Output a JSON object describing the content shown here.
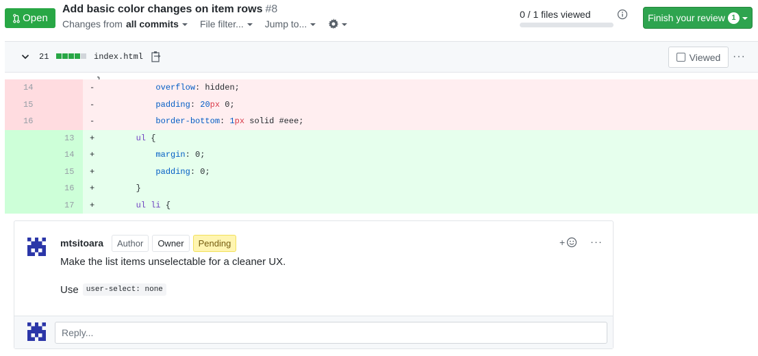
{
  "header": {
    "status_label": "Open",
    "title": "Add basic color changes on item rows",
    "number": "#8",
    "changes_prefix": "Changes from",
    "changes_value": "all commits",
    "file_filter": "File filter...",
    "jump_to": "Jump to...",
    "files_viewed": "0 / 1 files viewed",
    "finish_review": "Finish your review",
    "finish_review_count": "1"
  },
  "file": {
    "changes_count": "21",
    "name": "index.html",
    "viewed_label": "Viewed",
    "more": "···"
  },
  "diff": {
    "partial_text": "}",
    "rows": [
      {
        "type": "del",
        "old": "14",
        "new": "",
        "marker": "-",
        "indent": "            ",
        "prop": "overflow",
        "rest": ": hidden;"
      },
      {
        "type": "del",
        "old": "15",
        "new": "",
        "marker": "-",
        "indent": "            ",
        "prop": "padding",
        "num": "20",
        "unit": "px",
        "rest": " 0;"
      },
      {
        "type": "del",
        "old": "16",
        "new": "",
        "marker": "-",
        "indent": "            ",
        "prop": "border-bottom",
        "num": "1",
        "unit": "px",
        "rest": " solid #eee;"
      },
      {
        "type": "add",
        "old": "",
        "new": "13",
        "marker": "+",
        "indent": "        ",
        "sel": "ul",
        "rest": " {"
      },
      {
        "type": "add",
        "old": "",
        "new": "14",
        "marker": "+",
        "indent": "            ",
        "prop": "margin",
        "rest": ": 0;"
      },
      {
        "type": "add",
        "old": "",
        "new": "15",
        "marker": "+",
        "indent": "            ",
        "prop": "padding",
        "rest": ": 0;"
      },
      {
        "type": "add",
        "old": "",
        "new": "16",
        "marker": "+",
        "indent": "        ",
        "rest": "}"
      },
      {
        "type": "add",
        "old": "",
        "new": "17",
        "marker": "+",
        "indent": "        ",
        "sel": "ul li",
        "rest": " {"
      }
    ]
  },
  "comment": {
    "author": "mtsitoara",
    "labels": [
      "Author",
      "Owner",
      "Pending"
    ],
    "react_plus": "+",
    "more": "···",
    "body": "Make the list items unselectable for a cleaner UX.",
    "use_prefix": "Use",
    "code": "user-select: none",
    "reply_placeholder": "Reply..."
  },
  "colors": {
    "open_green": "#28a745",
    "finish_green": "#2ea44f",
    "deleted_bg": "#ffeef0",
    "added_bg": "#e6ffed",
    "pending_bg": "#fff5b1",
    "avatar_color": "#2b36a8"
  }
}
